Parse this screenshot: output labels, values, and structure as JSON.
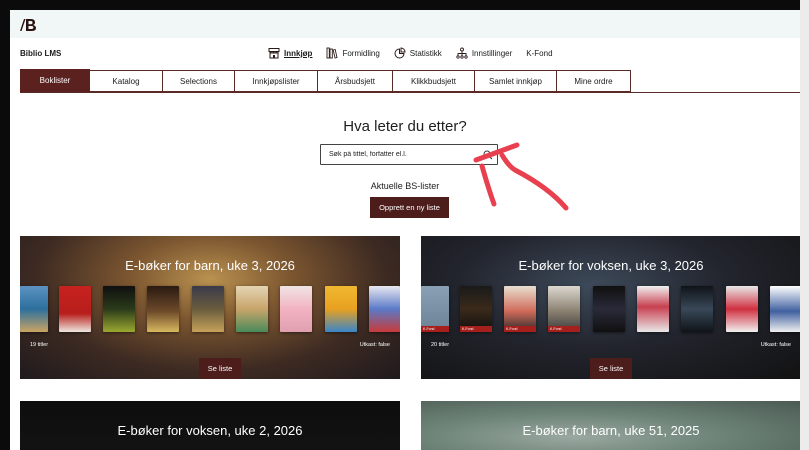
{
  "app": {
    "name": "Biblio LMS"
  },
  "nav": [
    {
      "label": "Innkjøp",
      "icon": "store-icon",
      "active": true
    },
    {
      "label": "Formidling",
      "icon": "books-icon",
      "active": false
    },
    {
      "label": "Statistikk",
      "icon": "pie-chart-icon",
      "active": false
    },
    {
      "label": "Innstillinger",
      "icon": "org-chart-icon",
      "active": false
    },
    {
      "label": "K-Fond",
      "icon": "",
      "active": false
    }
  ],
  "tabs": [
    {
      "label": "Boklister",
      "active": true
    },
    {
      "label": "Katalog"
    },
    {
      "label": "Selections"
    },
    {
      "label": "Innkjøpslister"
    },
    {
      "label": "Årsbudsjett"
    },
    {
      "label": "Klikkbudsjett"
    },
    {
      "label": "Samlet innkjøp"
    },
    {
      "label": "Mine ordre"
    }
  ],
  "search": {
    "title": "Hva leter du etter?",
    "placeholder": "Søk på tittel, forfatter el.l."
  },
  "lists": {
    "label": "Aktuelle BS-lister",
    "create_label": "Opprett en ny liste"
  },
  "cards": [
    {
      "title": "E-bøker for barn, uke 3, 2026",
      "count": "19 titler",
      "draft": "Utkast: false",
      "see_label": "Se liste",
      "kfond_label": ""
    },
    {
      "title": "E-bøker for voksen, uke 3, 2026",
      "count": "20 titler",
      "draft": "Utkast: false",
      "see_label": "Se liste",
      "kfond_label": "K-Fond"
    },
    {
      "title": "E-bøker for voksen, uke 2, 2026"
    },
    {
      "title": "E-bøker for barn, uke 51, 2025"
    }
  ],
  "colors": {
    "brand": "#5a211f",
    "topbar": "#f1f6f6",
    "annotation_arrow": "#e8404f"
  }
}
